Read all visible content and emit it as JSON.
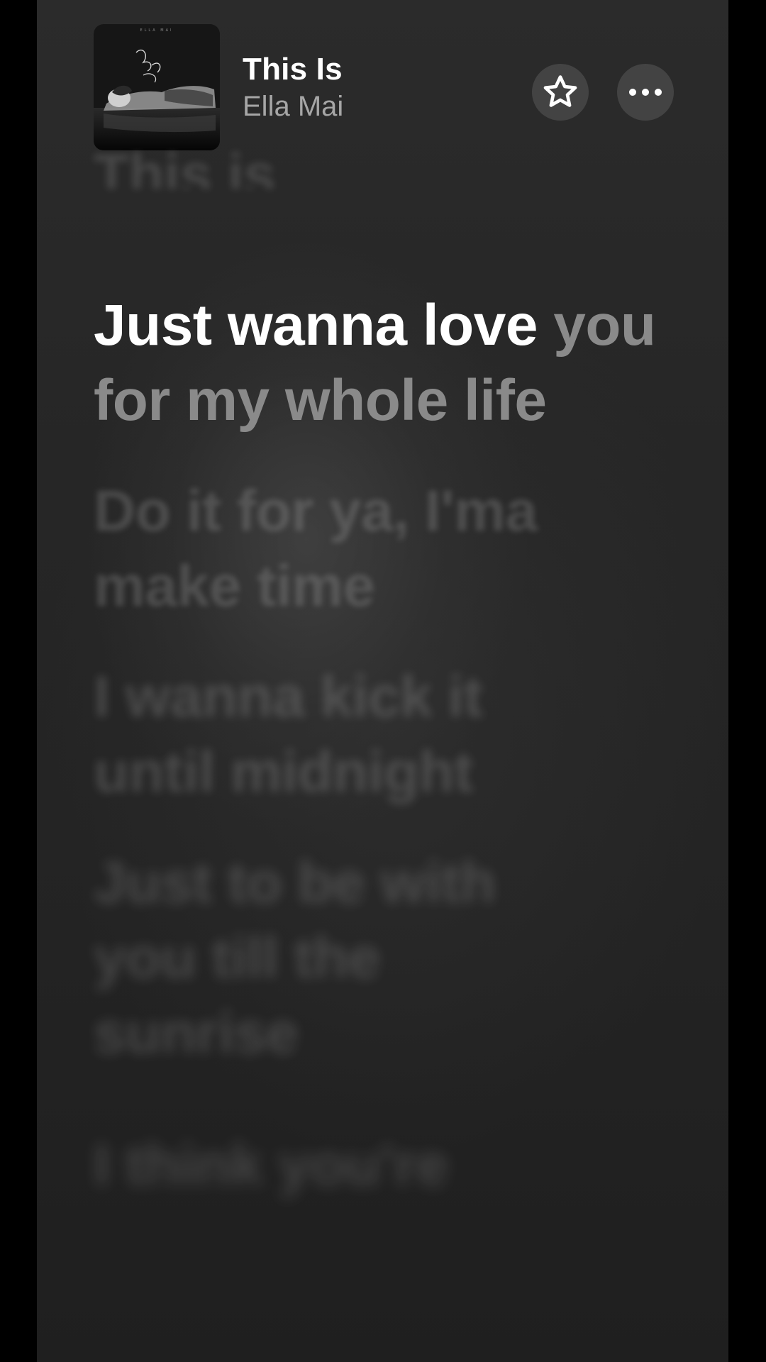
{
  "now_playing": {
    "title": "This Is",
    "artist": "Ella Mai",
    "album_art_icon": "album-cover-image"
  },
  "actions": {
    "favorite_icon": "star-icon",
    "more_icon": "ellipsis-icon"
  },
  "lyrics": {
    "previous_line": "This is",
    "current_line_sung": "Just wanna love",
    "current_line_unsung": "you for my whole life",
    "upcoming_lines": [
      "Do it for ya, I'ma make time",
      "I wanna kick it until midnight",
      "Just to be with you till the sunrise",
      "I think you're"
    ]
  },
  "colors": {
    "background": "#262626",
    "sung_text": "#ffffff",
    "unsung_text": "#8a8a8a",
    "artist_text": "#a6a6a6"
  }
}
